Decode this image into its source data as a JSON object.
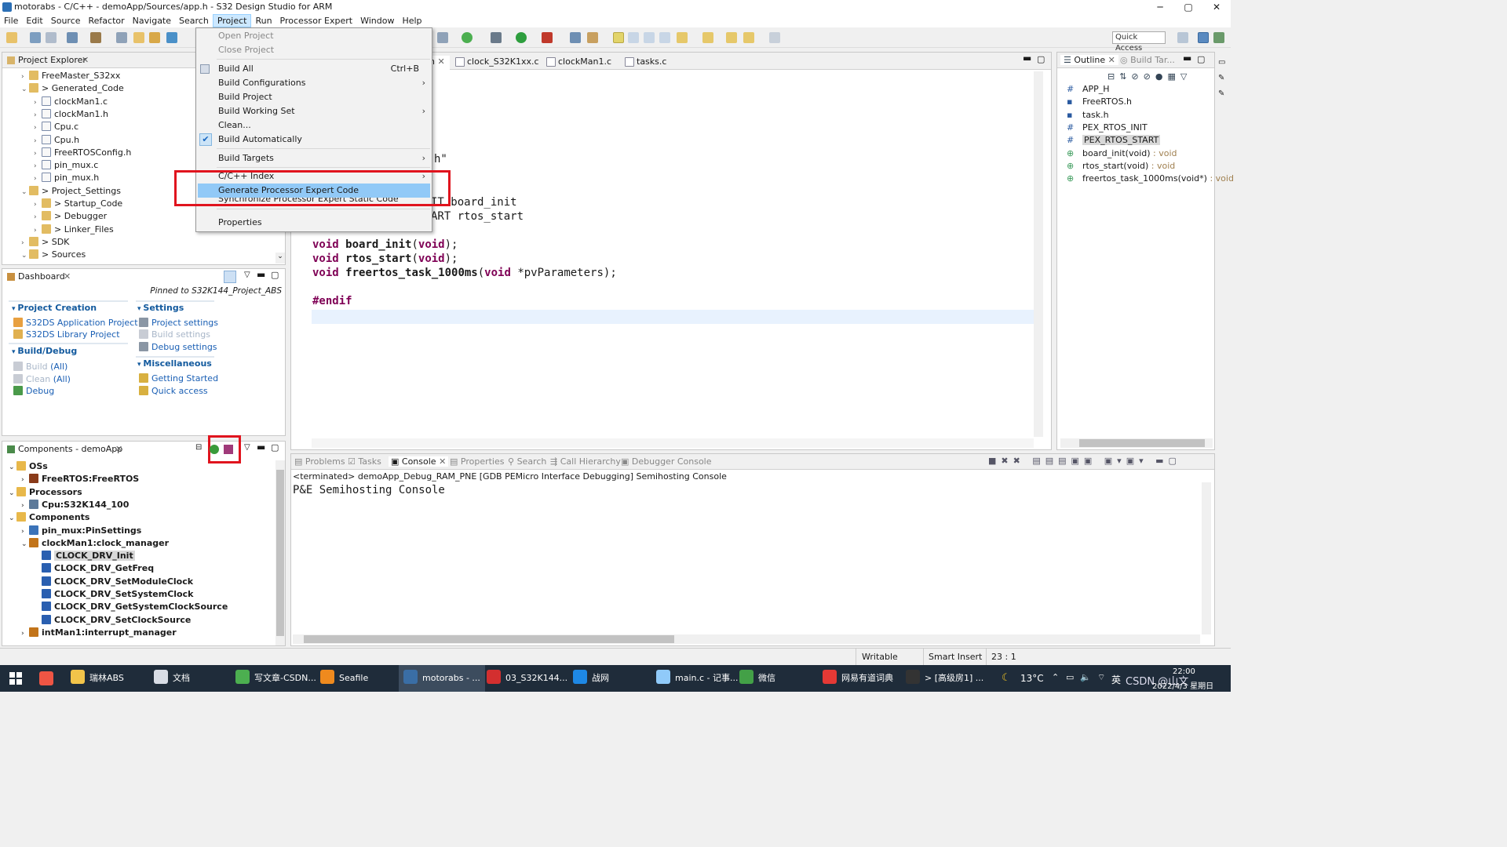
{
  "window": {
    "title": "motorabs - C/C++ - demoApp/Sources/app.h - S32 Design Studio for ARM",
    "min": "─",
    "max": "▢",
    "close": "✕"
  },
  "menubar": [
    "File",
    "Edit",
    "Source",
    "Refactor",
    "Navigate",
    "Search",
    "Project",
    "Run",
    "Processor Expert",
    "Window",
    "Help"
  ],
  "toolbar": {
    "quick_access": "Quick Access"
  },
  "project_menu": {
    "open_project": "Open Project",
    "close_project": "Close Project",
    "build_all": "Build All",
    "build_all_shortcut": "Ctrl+B",
    "build_configurations": "Build Configurations",
    "build_project": "Build Project",
    "build_working_set": "Build Working Set",
    "clean": "Clean...",
    "build_automatically": "Build Automatically",
    "build_targets": "Build Targets",
    "cpp_index": "C/C++ Index",
    "generate_pe_code": "Generate Processor Expert Code",
    "synchronize_pe": "Synchronize Processor Expert Static Code",
    "properties": "Properties"
  },
  "project_explorer": {
    "title": "Project Explorer",
    "items": [
      {
        "label": "FreeMaster_S32xx",
        "indent": 0,
        "tw": "›"
      },
      {
        "label": "> Generated_Code",
        "indent": 0,
        "tw": "⌄"
      },
      {
        "label": "clockMan1.c",
        "indent": 1,
        "tw": "›"
      },
      {
        "label": "clockMan1.h",
        "indent": 1,
        "tw": "›"
      },
      {
        "label": "Cpu.c",
        "indent": 1,
        "tw": "›"
      },
      {
        "label": "Cpu.h",
        "indent": 1,
        "tw": "›"
      },
      {
        "label": "FreeRTOSConfig.h",
        "indent": 1,
        "tw": "›"
      },
      {
        "label": "pin_mux.c",
        "indent": 1,
        "tw": "›"
      },
      {
        "label": "pin_mux.h",
        "indent": 1,
        "tw": "›"
      },
      {
        "label": "> Project_Settings",
        "indent": 0,
        "tw": "⌄"
      },
      {
        "label": "> Startup_Code",
        "indent": 1,
        "tw": "›"
      },
      {
        "label": "> Debugger",
        "indent": 1,
        "tw": "›"
      },
      {
        "label": "> Linker_Files",
        "indent": 1,
        "tw": "›"
      },
      {
        "label": "> SDK",
        "indent": 0,
        "tw": "›"
      },
      {
        "label": "> Sources",
        "indent": 0,
        "tw": "⌄"
      }
    ]
  },
  "dashboard": {
    "title": "Dashboard",
    "pinned": "Pinned to S32K144_Project_ABS",
    "project_creation": "Project Creation",
    "app_project": "S32DS Application Project",
    "lib_project": "S32DS Library Project",
    "build_debug": "Build/Debug",
    "build": "Build",
    "build_all": "(All)",
    "clean": "Clean",
    "clean_all": "(All)",
    "debug": "Debug",
    "settings": "Settings",
    "project_settings": "Project settings",
    "build_settings": "Build settings",
    "debug_settings": "Debug settings",
    "misc": "Miscellaneous",
    "getting_started": "Getting Started",
    "quick_access": "Quick access"
  },
  "components": {
    "title": "Components - demoApp",
    "items": [
      {
        "label": "OSs",
        "indent": 0,
        "tw": "⌄",
        "bold": true,
        "color": "#e8b84a"
      },
      {
        "label": "FreeRTOS:FreeRTOS",
        "indent": 1,
        "tw": "›",
        "bold": true,
        "color": "#8a3b1a"
      },
      {
        "label": "Processors",
        "indent": 0,
        "tw": "⌄",
        "bold": true,
        "color": "#e8b84a"
      },
      {
        "label": "Cpu:S32K144_100",
        "indent": 1,
        "tw": "›",
        "bold": true,
        "color": "#5d7a9a"
      },
      {
        "label": "Components",
        "indent": 0,
        "tw": "⌄",
        "bold": true,
        "color": "#e8b84a"
      },
      {
        "label": "pin_mux:PinSettings",
        "indent": 1,
        "tw": "›",
        "bold": true,
        "color": "#3b73b9"
      },
      {
        "label": "clockMan1:clock_manager",
        "indent": 1,
        "tw": "⌄",
        "bold": true,
        "color": "#c2741a"
      },
      {
        "label": "CLOCK_DRV_Init",
        "indent": 2,
        "tw": "",
        "bold": true,
        "color": "#2a5fb0",
        "sel": true
      },
      {
        "label": "CLOCK_DRV_GetFreq",
        "indent": 2,
        "tw": "",
        "bold": true,
        "color": "#2a5fb0"
      },
      {
        "label": "CLOCK_DRV_SetModuleClock",
        "indent": 2,
        "tw": "",
        "bold": true,
        "color": "#2a5fb0"
      },
      {
        "label": "CLOCK_DRV_SetSystemClock",
        "indent": 2,
        "tw": "",
        "bold": true,
        "color": "#2a5fb0"
      },
      {
        "label": "CLOCK_DRV_GetSystemClockSource",
        "indent": 2,
        "tw": "",
        "bold": true,
        "color": "#2a5fb0"
      },
      {
        "label": "CLOCK_DRV_SetClockSource",
        "indent": 2,
        "tw": "",
        "bold": true,
        "color": "#2a5fb0"
      },
      {
        "label": "intMan1:interrupt_manager",
        "indent": 1,
        "tw": "›",
        "bold": true,
        "color": "#c2741a"
      }
    ]
  },
  "editor": {
    "tabs": [
      "h",
      "clock_S32K1xx.c",
      "clockMan1.c",
      "tasks.c"
    ],
    "frag_h": "h\"",
    "frag_board": "IT board_init",
    "frag_rtos": "ART rtos_start",
    "line_board_fn": "board_init",
    "line_rtos_fn": "rtos_start",
    "line_task_fn": "freertos_task_1000ms",
    "kw_void": "void",
    "arg_void": "void",
    "task_param": "*pvParameters);",
    "endif": "#endif"
  },
  "outline": {
    "title": "Outline",
    "build_targets": "Build Tar...",
    "items": [
      {
        "label": "APP_H",
        "type": "",
        "icon": "#"
      },
      {
        "label": "FreeRTOS.h",
        "type": "",
        "icon": "▪"
      },
      {
        "label": "task.h",
        "type": "",
        "icon": "▪"
      },
      {
        "label": "PEX_RTOS_INIT",
        "type": "",
        "icon": "#"
      },
      {
        "label": "PEX_RTOS_START",
        "type": "",
        "icon": "#",
        "sel": true
      },
      {
        "label": "board_init(void)",
        "type": " : void",
        "icon": "⊕"
      },
      {
        "label": "rtos_start(void)",
        "type": " : void",
        "icon": "⊕"
      },
      {
        "label": "freertos_task_1000ms(void*)",
        "type": " : void",
        "icon": "⊕"
      }
    ]
  },
  "console": {
    "tabs": [
      "Problems",
      "Tasks",
      "Console",
      "Properties",
      "Search",
      "Call Hierarchy",
      "Debugger Console"
    ],
    "terminated": "<terminated> demoApp_Debug_RAM_PNE [GDB PEMicro Interface Debugging] Semihosting Console",
    "output": "P&E Semihosting Console"
  },
  "status": {
    "writable": "Writable",
    "insert": "Smart Insert",
    "pos": "23 : 1"
  },
  "taskbar": {
    "items": [
      {
        "label": "瑞林ABS",
        "color": "#f2c44a"
      },
      {
        "label": "文档",
        "color": "#d8dde6"
      },
      {
        "label": "写文章-CSDN...",
        "color": "#4caf50"
      },
      {
        "label": "Seafile",
        "color": "#ef8a1e"
      },
      {
        "label": "motorabs - ...",
        "color": "#3a6ea5"
      },
      {
        "label": "03_S32K144...",
        "color": "#d32f2f"
      },
      {
        "label": "战网",
        "color": "#1e88e5"
      },
      {
        "label": "main.c - 记事...",
        "color": "#90caf9"
      },
      {
        "label": "微信",
        "color": "#43a047"
      },
      {
        "label": "网易有道词典",
        "color": "#e53935"
      },
      {
        "label": "> [高级房1] ...",
        "color": "#333"
      }
    ],
    "temp": "13°C",
    "lang": "英",
    "time": "22:00",
    "date": "2022/4/3 星期日",
    "watermark": "CSDN @山文"
  }
}
